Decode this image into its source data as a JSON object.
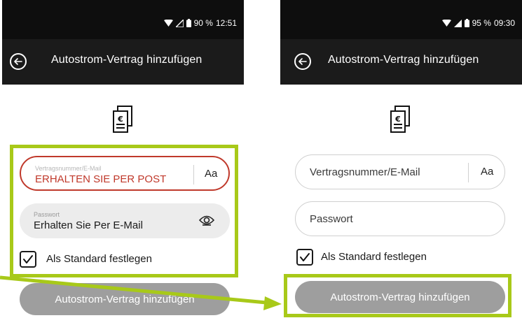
{
  "colors": {
    "status_bar": "#0e0e0e",
    "app_bar": "#1b1b1b",
    "error_red": "#c0392b",
    "highlight_green": "#a8c919",
    "button_gray": "#9e9e9e"
  },
  "left": {
    "status": {
      "battery": "90 %",
      "time": "12:51"
    },
    "header": {
      "title": "Autostrom-Vertrag hinzufügen"
    },
    "contract_field": {
      "label": "Vertragsnummer/E-Mail",
      "value": "ERHALTEN SIE PER POST",
      "toggle": "Aa"
    },
    "password_field": {
      "label": "Passwort",
      "value": "Erhalten Sie Per E-Mail"
    },
    "default_checkbox": {
      "label": "Als Standard festlegen",
      "checked": true
    },
    "submit_button": {
      "label": "Autostrom-Vertrag hinzufügen"
    }
  },
  "right": {
    "status": {
      "battery": "95 %",
      "time": "09:30"
    },
    "header": {
      "title": "Autostrom-Vertrag hinzufügen"
    },
    "contract_field": {
      "placeholder": "Vertragsnummer/E-Mail",
      "toggle": "Aa"
    },
    "password_field": {
      "placeholder": "Passwort"
    },
    "default_checkbox": {
      "label": "Als Standard festlegen",
      "checked": true
    },
    "submit_button": {
      "label": "Autostrom-Vertrag hinzufügen"
    }
  }
}
